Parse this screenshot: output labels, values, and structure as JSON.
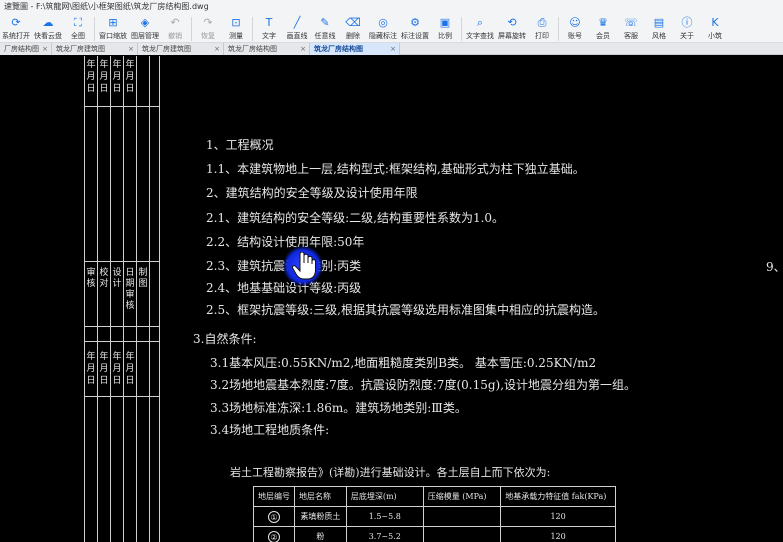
{
  "window": {
    "title": "速覽圖 - F:\\筑龍网\\图纸\\小框架图纸\\筑龙厂房结构图.dwg"
  },
  "toolbar": [
    {
      "label": "系统打开",
      "icon": "open-icon",
      "glyph": "⟳",
      "dim": false
    },
    {
      "label": "快看云盘",
      "icon": "cloud-icon",
      "glyph": "☁",
      "dim": false
    },
    {
      "label": "全图",
      "icon": "fit-view-icon",
      "glyph": "⛶",
      "dim": false
    },
    {
      "label": "窗口缩放",
      "icon": "window-zoom-icon",
      "glyph": "⊞",
      "dim": false
    },
    {
      "label": "图层管理",
      "icon": "layers-icon",
      "glyph": "◈",
      "dim": false
    },
    {
      "label": "撤销",
      "icon": "undo-icon",
      "glyph": "↶",
      "dim": true
    },
    {
      "label": "恢复",
      "icon": "redo-icon",
      "glyph": "↷",
      "dim": true
    },
    {
      "label": "测量",
      "icon": "measure-icon",
      "glyph": "⊡",
      "dim": false
    },
    {
      "label": "文字",
      "icon": "text-icon",
      "glyph": "T",
      "dim": false
    },
    {
      "label": "画直线",
      "icon": "line-icon",
      "glyph": "╱",
      "dim": false
    },
    {
      "label": "任意线",
      "icon": "freehand-icon",
      "glyph": "✎",
      "dim": false
    },
    {
      "label": "删除",
      "icon": "eraser-icon",
      "glyph": "⌫",
      "dim": false
    },
    {
      "label": "隐藏标注",
      "icon": "hide-annotation-icon",
      "glyph": "◎",
      "dim": false
    },
    {
      "label": "标注设置",
      "icon": "annotation-settings-icon",
      "glyph": "⚙",
      "dim": false
    },
    {
      "label": "比例",
      "icon": "scale-icon",
      "glyph": "▣",
      "dim": false
    },
    {
      "label": "文字查找",
      "icon": "text-search-icon",
      "glyph": "⌕",
      "dim": false
    },
    {
      "label": "屏幕旋转",
      "icon": "rotate-screen-icon",
      "glyph": "⟲",
      "dim": false
    },
    {
      "label": "打印",
      "icon": "print-icon",
      "glyph": "⎙",
      "dim": false
    },
    {
      "label": "账号",
      "icon": "account-icon",
      "glyph": "☺",
      "dim": false
    },
    {
      "label": "会员",
      "icon": "vip-icon",
      "glyph": "♛",
      "dim": false
    },
    {
      "label": "客服",
      "icon": "customer-service-icon",
      "glyph": "☏",
      "dim": false
    },
    {
      "label": "风格",
      "icon": "style-icon",
      "glyph": "▤",
      "dim": false
    },
    {
      "label": "关于",
      "icon": "about-icon",
      "glyph": "ⓘ",
      "dim": false
    },
    {
      "label": "小筑",
      "icon": "assistant-icon",
      "glyph": "K",
      "dim": false
    }
  ],
  "tabs": [
    {
      "label": "厂房结构图",
      "active": false
    },
    {
      "label": "筑龙厂房建筑图",
      "active": false
    },
    {
      "label": "筑龙厂房建筑图",
      "active": false
    },
    {
      "label": "筑龙厂房结构图",
      "active": false
    },
    {
      "label": "筑龙厂房结构图",
      "active": true
    }
  ],
  "tab_close": "×",
  "drawing": {
    "strip_chars": {
      "col1": [
        "年",
        "月",
        "日",
        "年",
        "月",
        "日"
      ],
      "col2": [
        "年",
        "月",
        "日",
        "年",
        "月",
        "日"
      ],
      "col3": [
        "年",
        "月",
        "日",
        "年",
        "月",
        "日"
      ],
      "col4": [
        "年",
        "月",
        "日",
        "年",
        "月",
        "日"
      ],
      "mid_col1": "审核",
      "mid_col2": "校对",
      "mid_col3": "设计",
      "mid_col4": "日期审核",
      "mid_col5": "制图"
    },
    "lines": [
      "1、工程概况",
      "1.1、本建筑物地上一层,结构型式:框架结构,基础形式为柱下独立基础。",
      "2、建筑结构的安全等级及设计使用年限",
      "2.1、建筑结构的安全等级:二级,结构重要性系数为1.0。",
      "2.2、结构设计使用年限:50年",
      "2.3、建筑抗震设防类别:丙类",
      "2.4、地基基础设计等级:丙级",
      "2.5、框架抗震等级:三级,根据其抗震等级选用标准图集中相应的抗震构造。",
      "3.自然条件:",
      "3.1基本风压:0.55KN/m2,地面粗糙度类别B类。    基本雪压:0.25KN/m2",
      "3.2场地地震基本烈度:7度。抗震设防烈度:7度(0.15g),设计地震分组为第一组。",
      "3.3场地标准冻深:1.86m。建筑场地类别:Ⅲ类。",
      "3.4场地工程地质条件:",
      "岩土工程勘察报告》(详勘)进行基础设计。各土层自上而下依次为:"
    ],
    "right_edge": "9、",
    "table": {
      "headers": [
        "地层编号",
        "地层名称",
        "层底埋深(m)",
        "压缩模量   (MPa)",
        "地基承载力特征值      fak(KPa)"
      ],
      "rows": [
        [
          "①",
          "素填粉质土",
          "1.5~5.8",
          "",
          "120"
        ],
        [
          "②",
          "粉",
          "3.7~5.2",
          "",
          "120"
        ]
      ]
    }
  }
}
